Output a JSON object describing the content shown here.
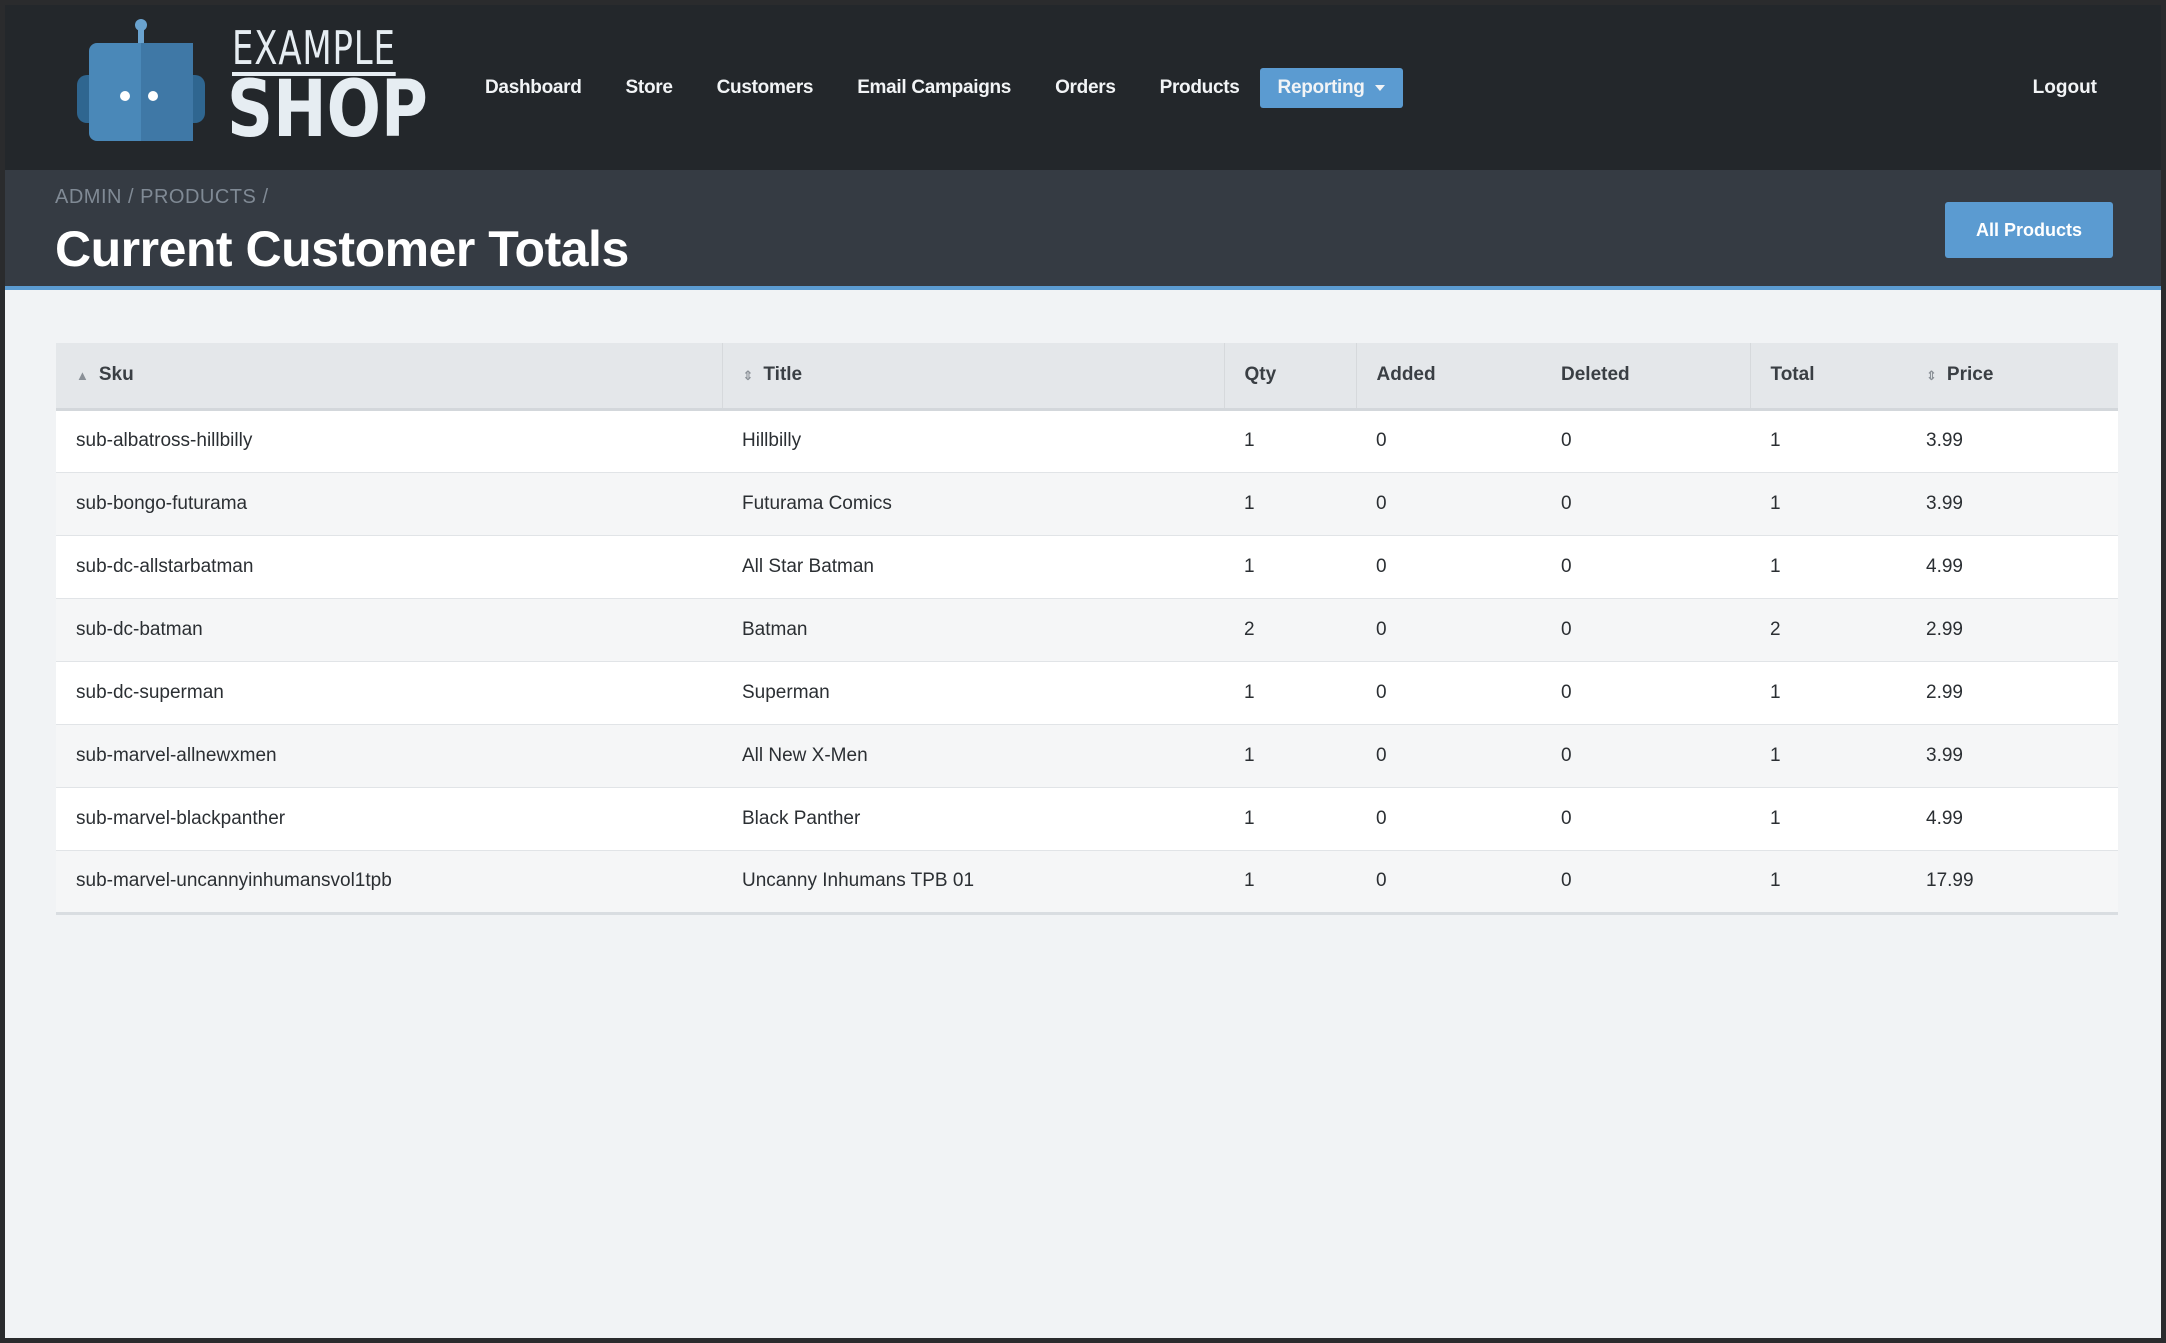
{
  "logo": {
    "top": "EXAMPLE",
    "bottom": "SHOP"
  },
  "nav": {
    "items": [
      "Dashboard",
      "Store",
      "Customers",
      "Email Campaigns",
      "Orders",
      "Products"
    ],
    "active": "Reporting",
    "logout": "Logout"
  },
  "header": {
    "breadcrumb": [
      "ADMIN",
      "/",
      "PRODUCTS",
      "/"
    ],
    "title": "Current Customer Totals",
    "action_button": "All Products"
  },
  "table": {
    "columns": [
      "Sku",
      "Title",
      "Qty",
      "Added",
      "Deleted",
      "Total",
      "Price"
    ],
    "rows": [
      [
        "sub-albatross-hillbilly",
        "Hillbilly",
        "1",
        "0",
        "0",
        "1",
        "3.99"
      ],
      [
        "sub-bongo-futurama",
        "Futurama Comics",
        "1",
        "0",
        "0",
        "1",
        "3.99"
      ],
      [
        "sub-dc-allstarbatman",
        "All Star Batman",
        "1",
        "0",
        "0",
        "1",
        "4.99"
      ],
      [
        "sub-dc-batman",
        "Batman",
        "2",
        "0",
        "0",
        "2",
        "2.99"
      ],
      [
        "sub-dc-superman",
        "Superman",
        "1",
        "0",
        "0",
        "1",
        "2.99"
      ],
      [
        "sub-marvel-allnewxmen",
        "All New X-Men",
        "1",
        "0",
        "0",
        "1",
        "3.99"
      ],
      [
        "sub-marvel-blackpanther",
        "Black Panther",
        "1",
        "0",
        "0",
        "1",
        "4.99"
      ],
      [
        "sub-marvel-uncannyinhumansvol1tpb",
        "Uncanny Inhumans TPB 01",
        "1",
        "0",
        "0",
        "1",
        "17.99"
      ]
    ]
  },
  "colors": {
    "accent": "#5b9bd1",
    "navbar": "#23272b",
    "header_band": "#353b43"
  }
}
